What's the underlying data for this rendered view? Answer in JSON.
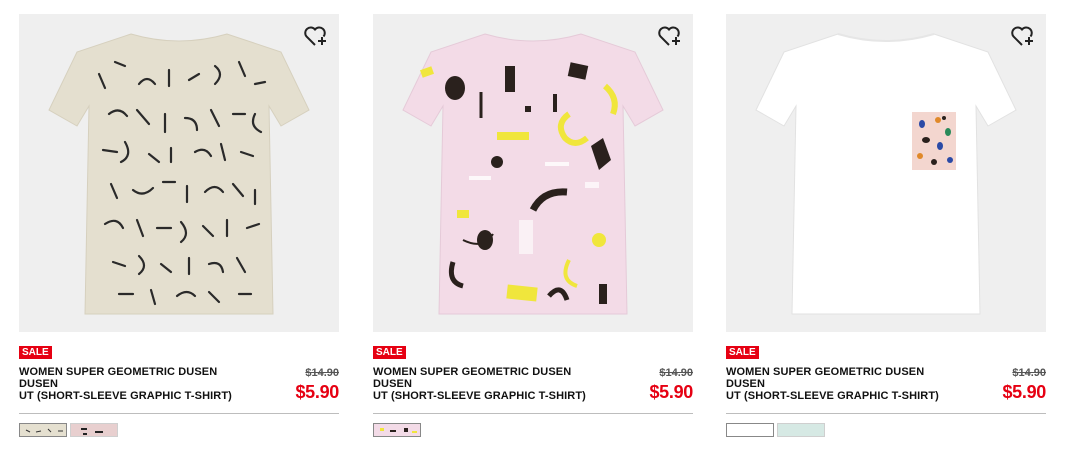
{
  "products": [
    {
      "badge": "SALE",
      "name_line1": "WOMEN SUPER GEOMETRIC DUSEN DUSEN",
      "name_line2": "UT (SHORT-SLEEVE GRAPHIC T-SHIRT)",
      "original_price": "$14.90",
      "sale_price": "$5.90",
      "image_bg": "#efefef",
      "tee_color": "#e4dfcf",
      "swatches": [
        {
          "color": "#e5e0d0",
          "pattern": "dashes"
        },
        {
          "color": "#e8cfcf",
          "pattern": "dashes"
        }
      ]
    },
    {
      "badge": "SALE",
      "name_line1": "WOMEN SUPER GEOMETRIC DUSEN DUSEN",
      "name_line2": "UT (SHORT-SLEEVE GRAPHIC T-SHIRT)",
      "original_price": "$14.90",
      "sale_price": "$5.90",
      "image_bg": "#efefef",
      "tee_color": "#f3dbe7",
      "swatches": [
        {
          "color": "#f3dbe7",
          "pattern": "dashes"
        }
      ]
    },
    {
      "badge": "SALE",
      "name_line1": "WOMEN SUPER GEOMETRIC DUSEN DUSEN",
      "name_line2": "UT (SHORT-SLEEVE GRAPHIC T-SHIRT)",
      "original_price": "$14.90",
      "sale_price": "$5.90",
      "image_bg": "#efefef",
      "tee_color": "#ffffff",
      "swatches": [
        {
          "color": "#ffffff",
          "pattern": "plain"
        },
        {
          "color": "#d6e9e4",
          "pattern": "plain"
        }
      ]
    }
  ],
  "colors": {
    "sale_red": "#e60012",
    "text_dark": "#111111",
    "rule": "#bdbdbd"
  },
  "icons": {
    "wishlist": "heart-plus-icon"
  }
}
